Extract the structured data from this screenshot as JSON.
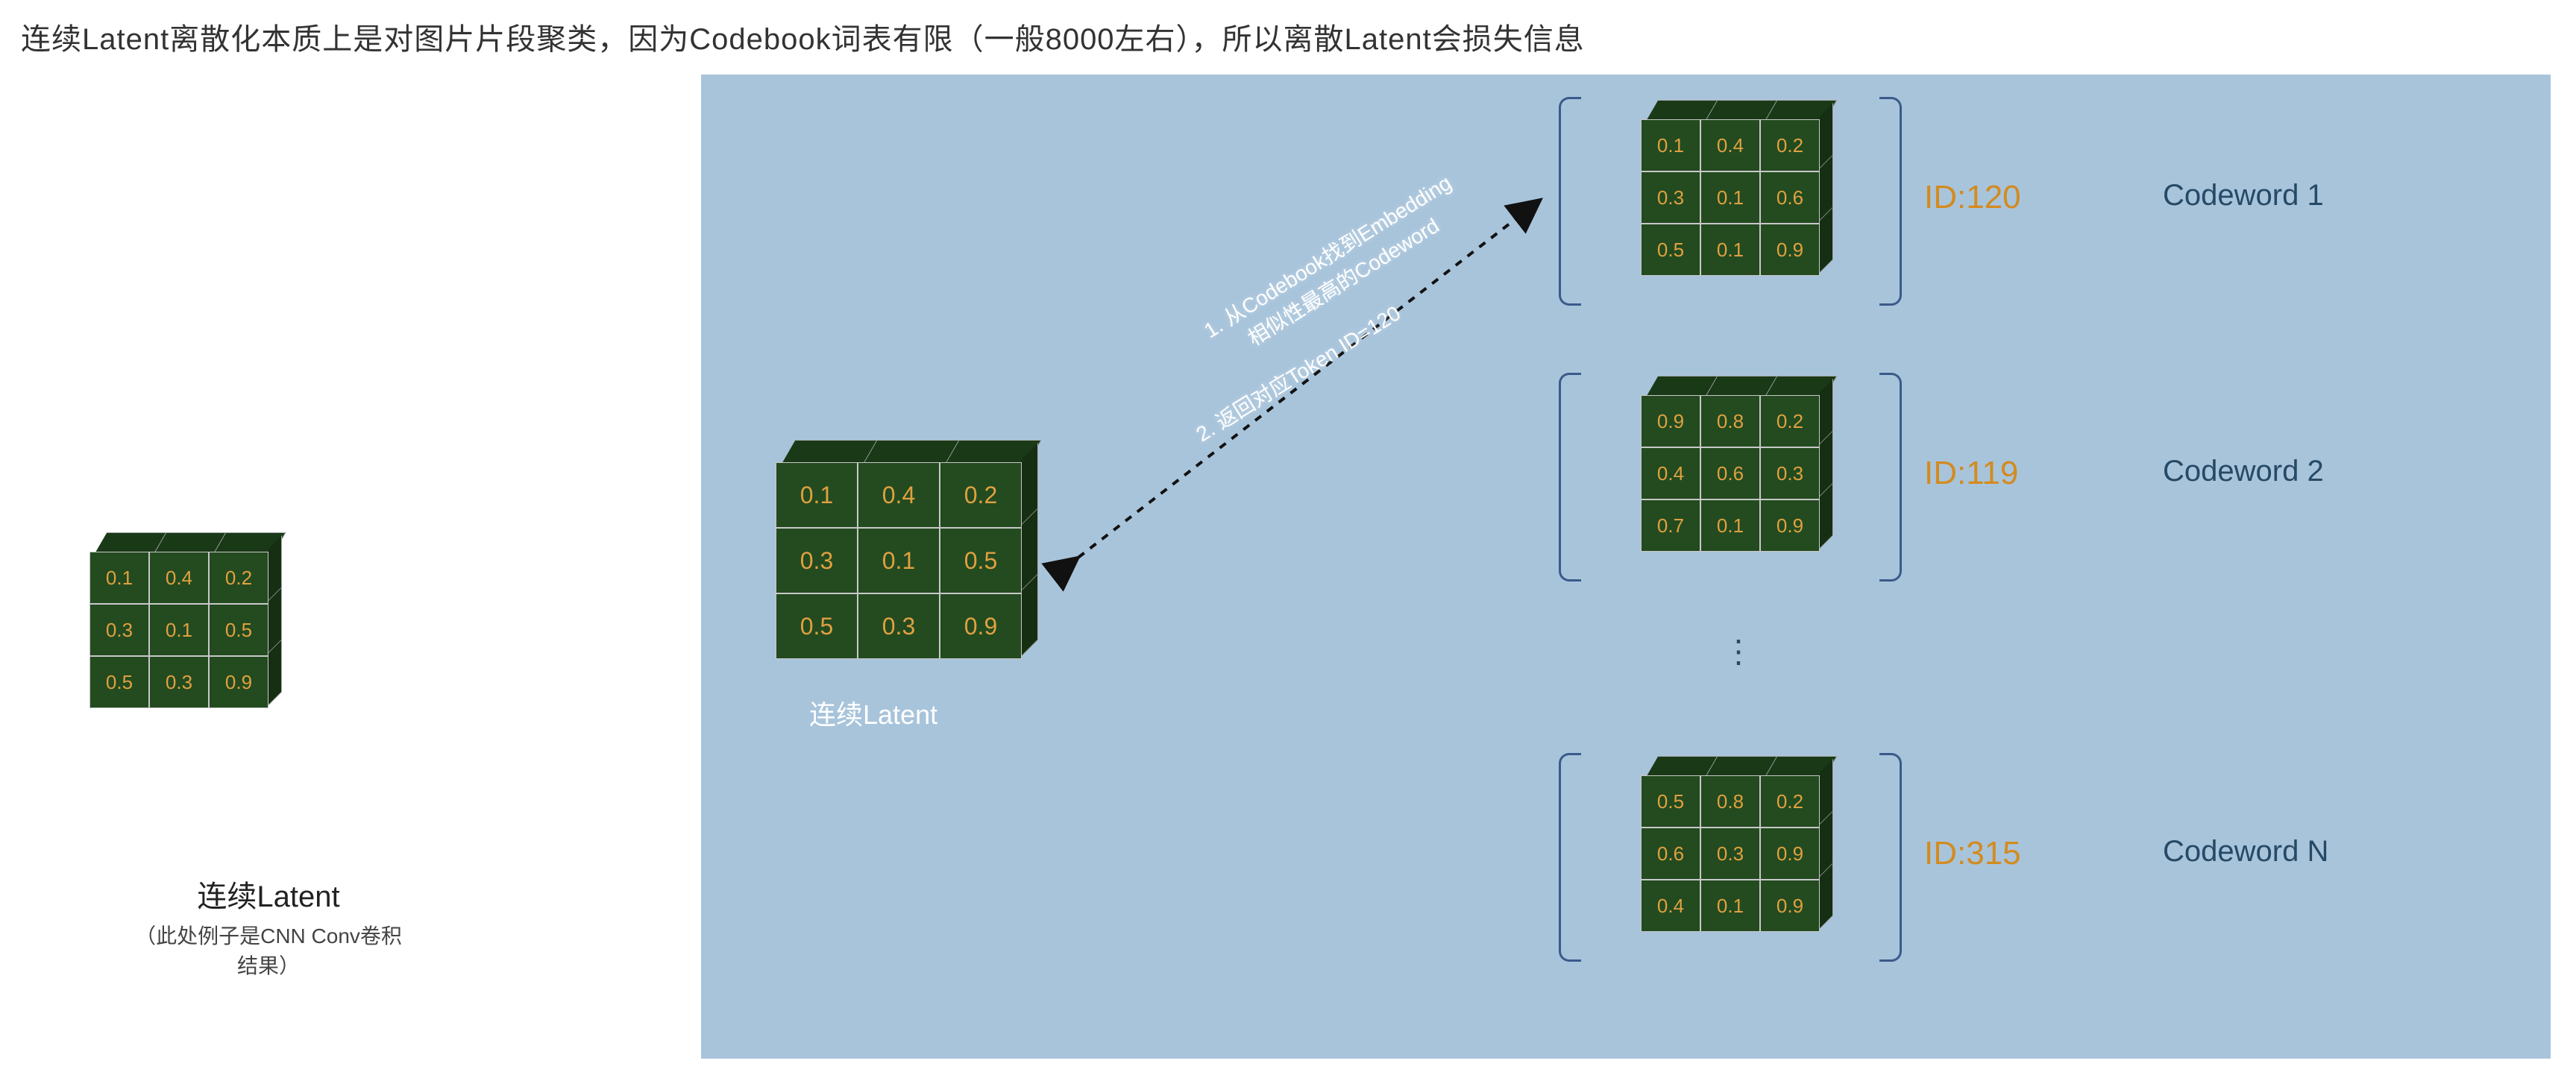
{
  "heading": "连续Latent离散化本质上是对图片片段聚类，因为Codebook词表有限（一般8000左右），所以离散Latent会损失信息",
  "left": {
    "label": "连续Latent",
    "sublabel": "（此处例子是CNN Conv卷积结果）",
    "grid": [
      [
        "0.1",
        "0.4",
        "0.2"
      ],
      [
        "0.3",
        "0.1",
        "0.5"
      ],
      [
        "0.5",
        "0.3",
        "0.9"
      ]
    ]
  },
  "panel": {
    "latent_label": "连续Latent",
    "latent_grid": [
      [
        "0.1",
        "0.4",
        "0.2"
      ],
      [
        "0.3",
        "0.1",
        "0.5"
      ],
      [
        "0.5",
        "0.3",
        "0.9"
      ]
    ],
    "arrow_text1_line1": "1. 从Codebook找到Embedding",
    "arrow_text1_line2": "相似性最高的Codeword",
    "arrow_text2": "2. 返回对应Token ID=120",
    "codewords": [
      {
        "id": "ID:120",
        "name": "Codeword 1",
        "grid": [
          [
            "0.1",
            "0.4",
            "0.2"
          ],
          [
            "0.3",
            "0.1",
            "0.6"
          ],
          [
            "0.5",
            "0.1",
            "0.9"
          ]
        ]
      },
      {
        "id": "ID:119",
        "name": "Codeword 2",
        "grid": [
          [
            "0.9",
            "0.8",
            "0.2"
          ],
          [
            "0.4",
            "0.6",
            "0.3"
          ],
          [
            "0.7",
            "0.1",
            "0.9"
          ]
        ]
      },
      {
        "id": "ID:315",
        "name": "Codeword N",
        "grid": [
          [
            "0.5",
            "0.8",
            "0.2"
          ],
          [
            "0.6",
            "0.3",
            "0.9"
          ],
          [
            "0.4",
            "0.1",
            "0.9"
          ]
        ]
      }
    ],
    "dots": "⋮"
  }
}
